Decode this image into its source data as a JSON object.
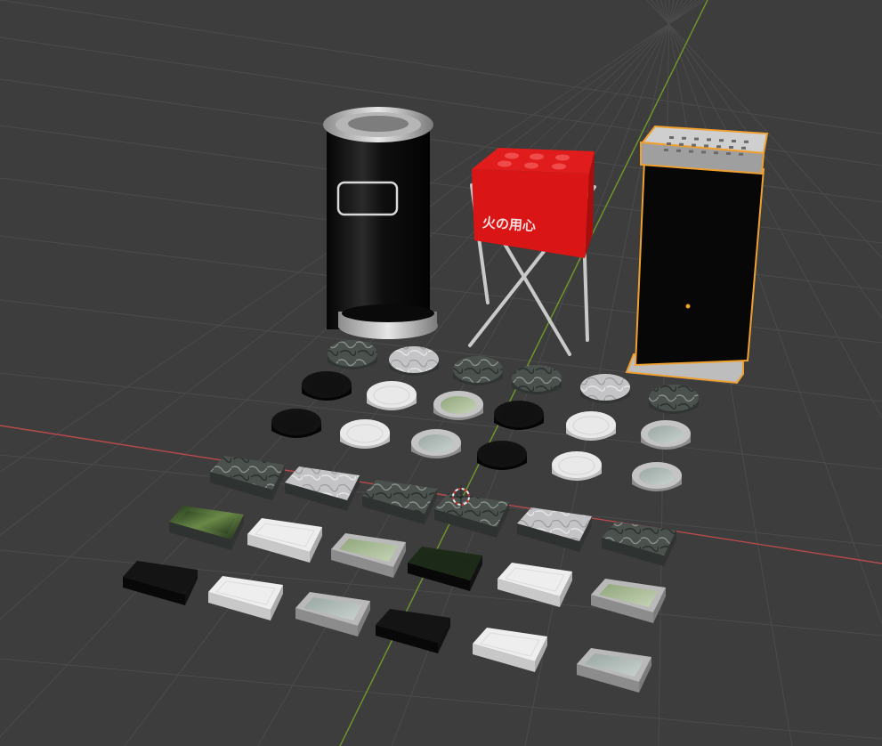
{
  "app": "3d-viewport",
  "scene": {
    "background": "#3d3d3d",
    "grid_color": "#4a4a4a",
    "x_axis_color": "#b84a4a",
    "y_axis_color": "#6f9a2a",
    "selection_color": "#f0a030"
  },
  "objects": {
    "stand_sign_text": "火の用心",
    "cylinder_bin": "cylinder-ashtray-bin",
    "red_box_stand": "folding-stand-ashtray",
    "tall_box_stand": "standing-box-ashtray"
  },
  "icons": {
    "cursor": "3d-cursor-icon",
    "origin": "object-origin-icon"
  }
}
